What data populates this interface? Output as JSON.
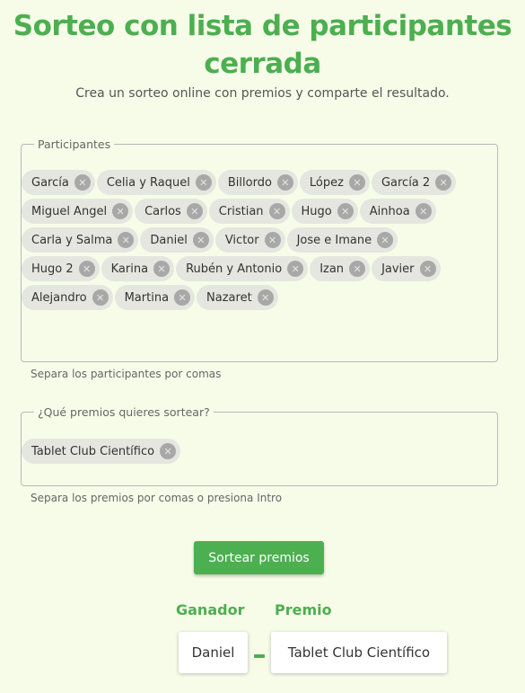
{
  "header": {
    "title": "Sorteo con lista de participantes cerrada",
    "subtitle": "Crea un sorteo online con premios y comparte el resultado."
  },
  "participants": {
    "legend": "Participantes",
    "helper": "Separa los participantes por comas",
    "items": [
      "García",
      "Celia y Raquel",
      "Billordo",
      "López",
      "García 2",
      "Miguel Angel",
      "Carlos",
      "Cristian",
      "Hugo",
      "Ainhoa",
      "Carla y Salma",
      "Daniel",
      "Victor",
      "Jose e Imane",
      "Hugo 2",
      "Karina",
      "Rubén y Antonio",
      "Izan",
      "Javier",
      "Alejandro",
      "Martina",
      "Nazaret"
    ]
  },
  "prizes": {
    "legend": "¿Qué premios quieres sortear?",
    "helper": "Separa los premios por comas o presiona Intro",
    "items": [
      "Tablet Club Científico"
    ]
  },
  "actions": {
    "draw_label": "Sortear premios"
  },
  "results": {
    "winner_header": "Ganador",
    "prize_header": "Premio",
    "winner": "Daniel",
    "prize": "Tablet Club Científico"
  },
  "colors": {
    "accent": "#4caf50",
    "background": "#f7fce9",
    "chip": "#e4e6df"
  },
  "icons": {
    "chip_remove": "close-circle-icon"
  }
}
